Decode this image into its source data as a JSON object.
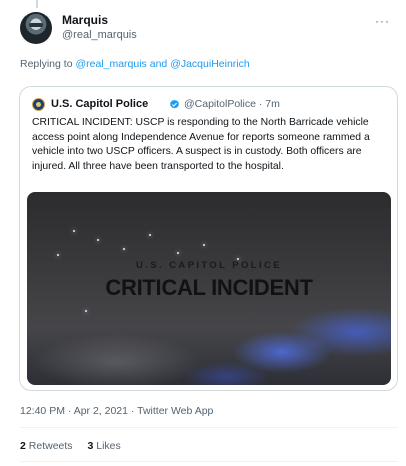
{
  "tweet": {
    "author": {
      "display_name": "Marquis",
      "handle": "@real_marquis"
    },
    "more_icon": "ellipsis-icon",
    "reply": {
      "prefix": "Replying to",
      "user1": "@real_marquis",
      "connector": "and",
      "user2": "@JacquiHeinrich"
    },
    "quoted": {
      "display_name": "U.S. Capitol Police",
      "verified_icon": "verified-badge-icon",
      "meta": "@CapitolPolice · 7m",
      "text": "CRITICAL INCIDENT: USCP is responding to the North Barricade vehicle access point along Independence Avenue for reports someone rammed a vehicle into two USCP officers. A suspect is in custody. Both officers are injured. All three have been transported to the hospital.",
      "media": {
        "subtitle": "U.S. CAPITOL POLICE",
        "title": "CRITICAL INCIDENT"
      }
    },
    "timestamp": "12:40 PM · Apr 2, 2021 · Twitter Web App",
    "stats": {
      "retweets_count": "2",
      "retweets_label": "Retweets",
      "likes_count": "3",
      "likes_label": "Likes"
    }
  },
  "colors": {
    "link": "#1d9bf0",
    "secondary_text": "#536471",
    "border": "#cfd9de"
  }
}
